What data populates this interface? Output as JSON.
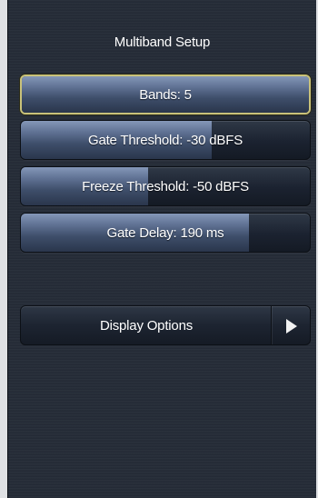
{
  "header": {
    "title": "Multiband Setup"
  },
  "controls": [
    {
      "label": "Bands: 5",
      "selected": true,
      "level": 1.0
    },
    {
      "label": "Gate Threshold: -30 dBFS",
      "selected": false,
      "level": 0.66
    },
    {
      "label": "Freeze Threshold: -50 dBFS",
      "selected": false,
      "level": 0.44
    },
    {
      "label": "Gate Delay: 190 ms",
      "selected": false,
      "level": 0.79
    }
  ],
  "nav": {
    "display_options_label": "Display Options",
    "icon": "chevron-right-icon"
  },
  "colors": {
    "panel_bg": "#252c37",
    "selection_border": "#c9c27a",
    "fill_top": "#8497b8"
  }
}
